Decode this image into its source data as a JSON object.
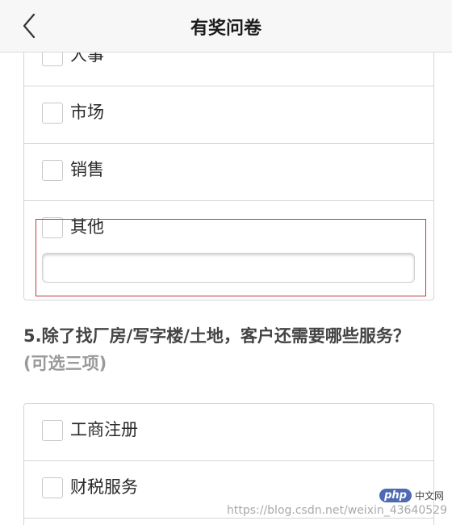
{
  "header": {
    "title": "有奖问卷",
    "back_icon": "chevron-left-icon"
  },
  "question4_options": [
    {
      "label": "人事",
      "checked": false
    },
    {
      "label": "市场",
      "checked": false
    },
    {
      "label": "销售",
      "checked": false
    },
    {
      "label": "其他",
      "checked": false,
      "other_input": {
        "value": "",
        "placeholder": ""
      }
    }
  ],
  "question5": {
    "text": "5.除了找厂房/写字楼/土地，客户还需要哪些服务？",
    "hint": "(可选三项)",
    "options": [
      {
        "label": "工商注册",
        "checked": false
      },
      {
        "label": "财税服务",
        "checked": false
      }
    ]
  },
  "watermark": {
    "logo_pill": "php",
    "logo_text": "中文网",
    "url": "https://blog.csdn.net/weixin_43640529"
  },
  "colors": {
    "highlight_border": "#c23a3a",
    "header_bg": "#f7f7f7",
    "hint_text": "#9a9a9a"
  }
}
